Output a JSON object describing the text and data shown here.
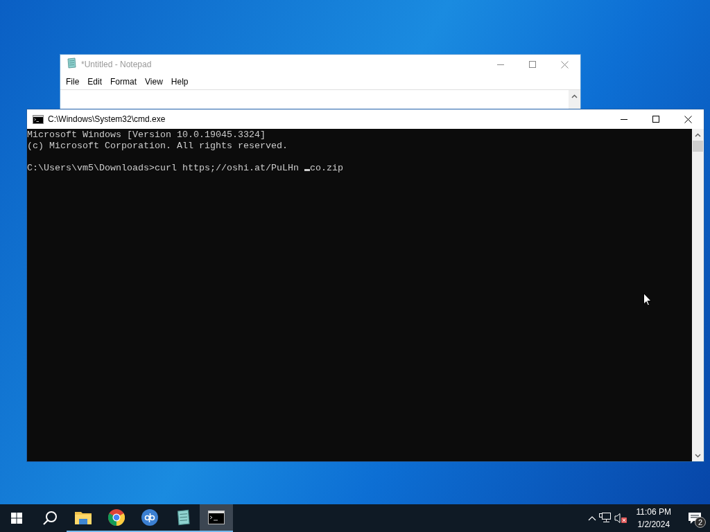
{
  "notepad": {
    "title": "*Untitled - Notepad",
    "active": false,
    "menu": [
      "File",
      "Edit",
      "Format",
      "View",
      "Help"
    ]
  },
  "console": {
    "title": "C:\\Windows\\System32\\cmd.exe",
    "active": true,
    "output_lines": [
      "Microsoft Windows [Version 10.0.19045.3324]",
      "(c) Microsoft Corporation. All rights reserved."
    ],
    "prompt": {
      "before_cursor": "C:\\Users\\vm5\\Downloads>curl https;//oshi.at/PuLHn ",
      "after_cursor": "co.zip"
    }
  },
  "taskbar": {
    "apps": [
      {
        "kind": "folder",
        "running": true,
        "selected": false
      },
      {
        "kind": "browser",
        "running": true,
        "selected": false
      },
      {
        "kind": "torrent",
        "running": true,
        "selected": false
      },
      {
        "kind": "notepad",
        "running": true,
        "selected": false
      },
      {
        "kind": "terminal",
        "running": true,
        "selected": true
      }
    ],
    "volume_muted": true,
    "clock": {
      "time": "11:06 PM",
      "date": "1/2/2024"
    },
    "notifications": {
      "count": "2"
    }
  }
}
